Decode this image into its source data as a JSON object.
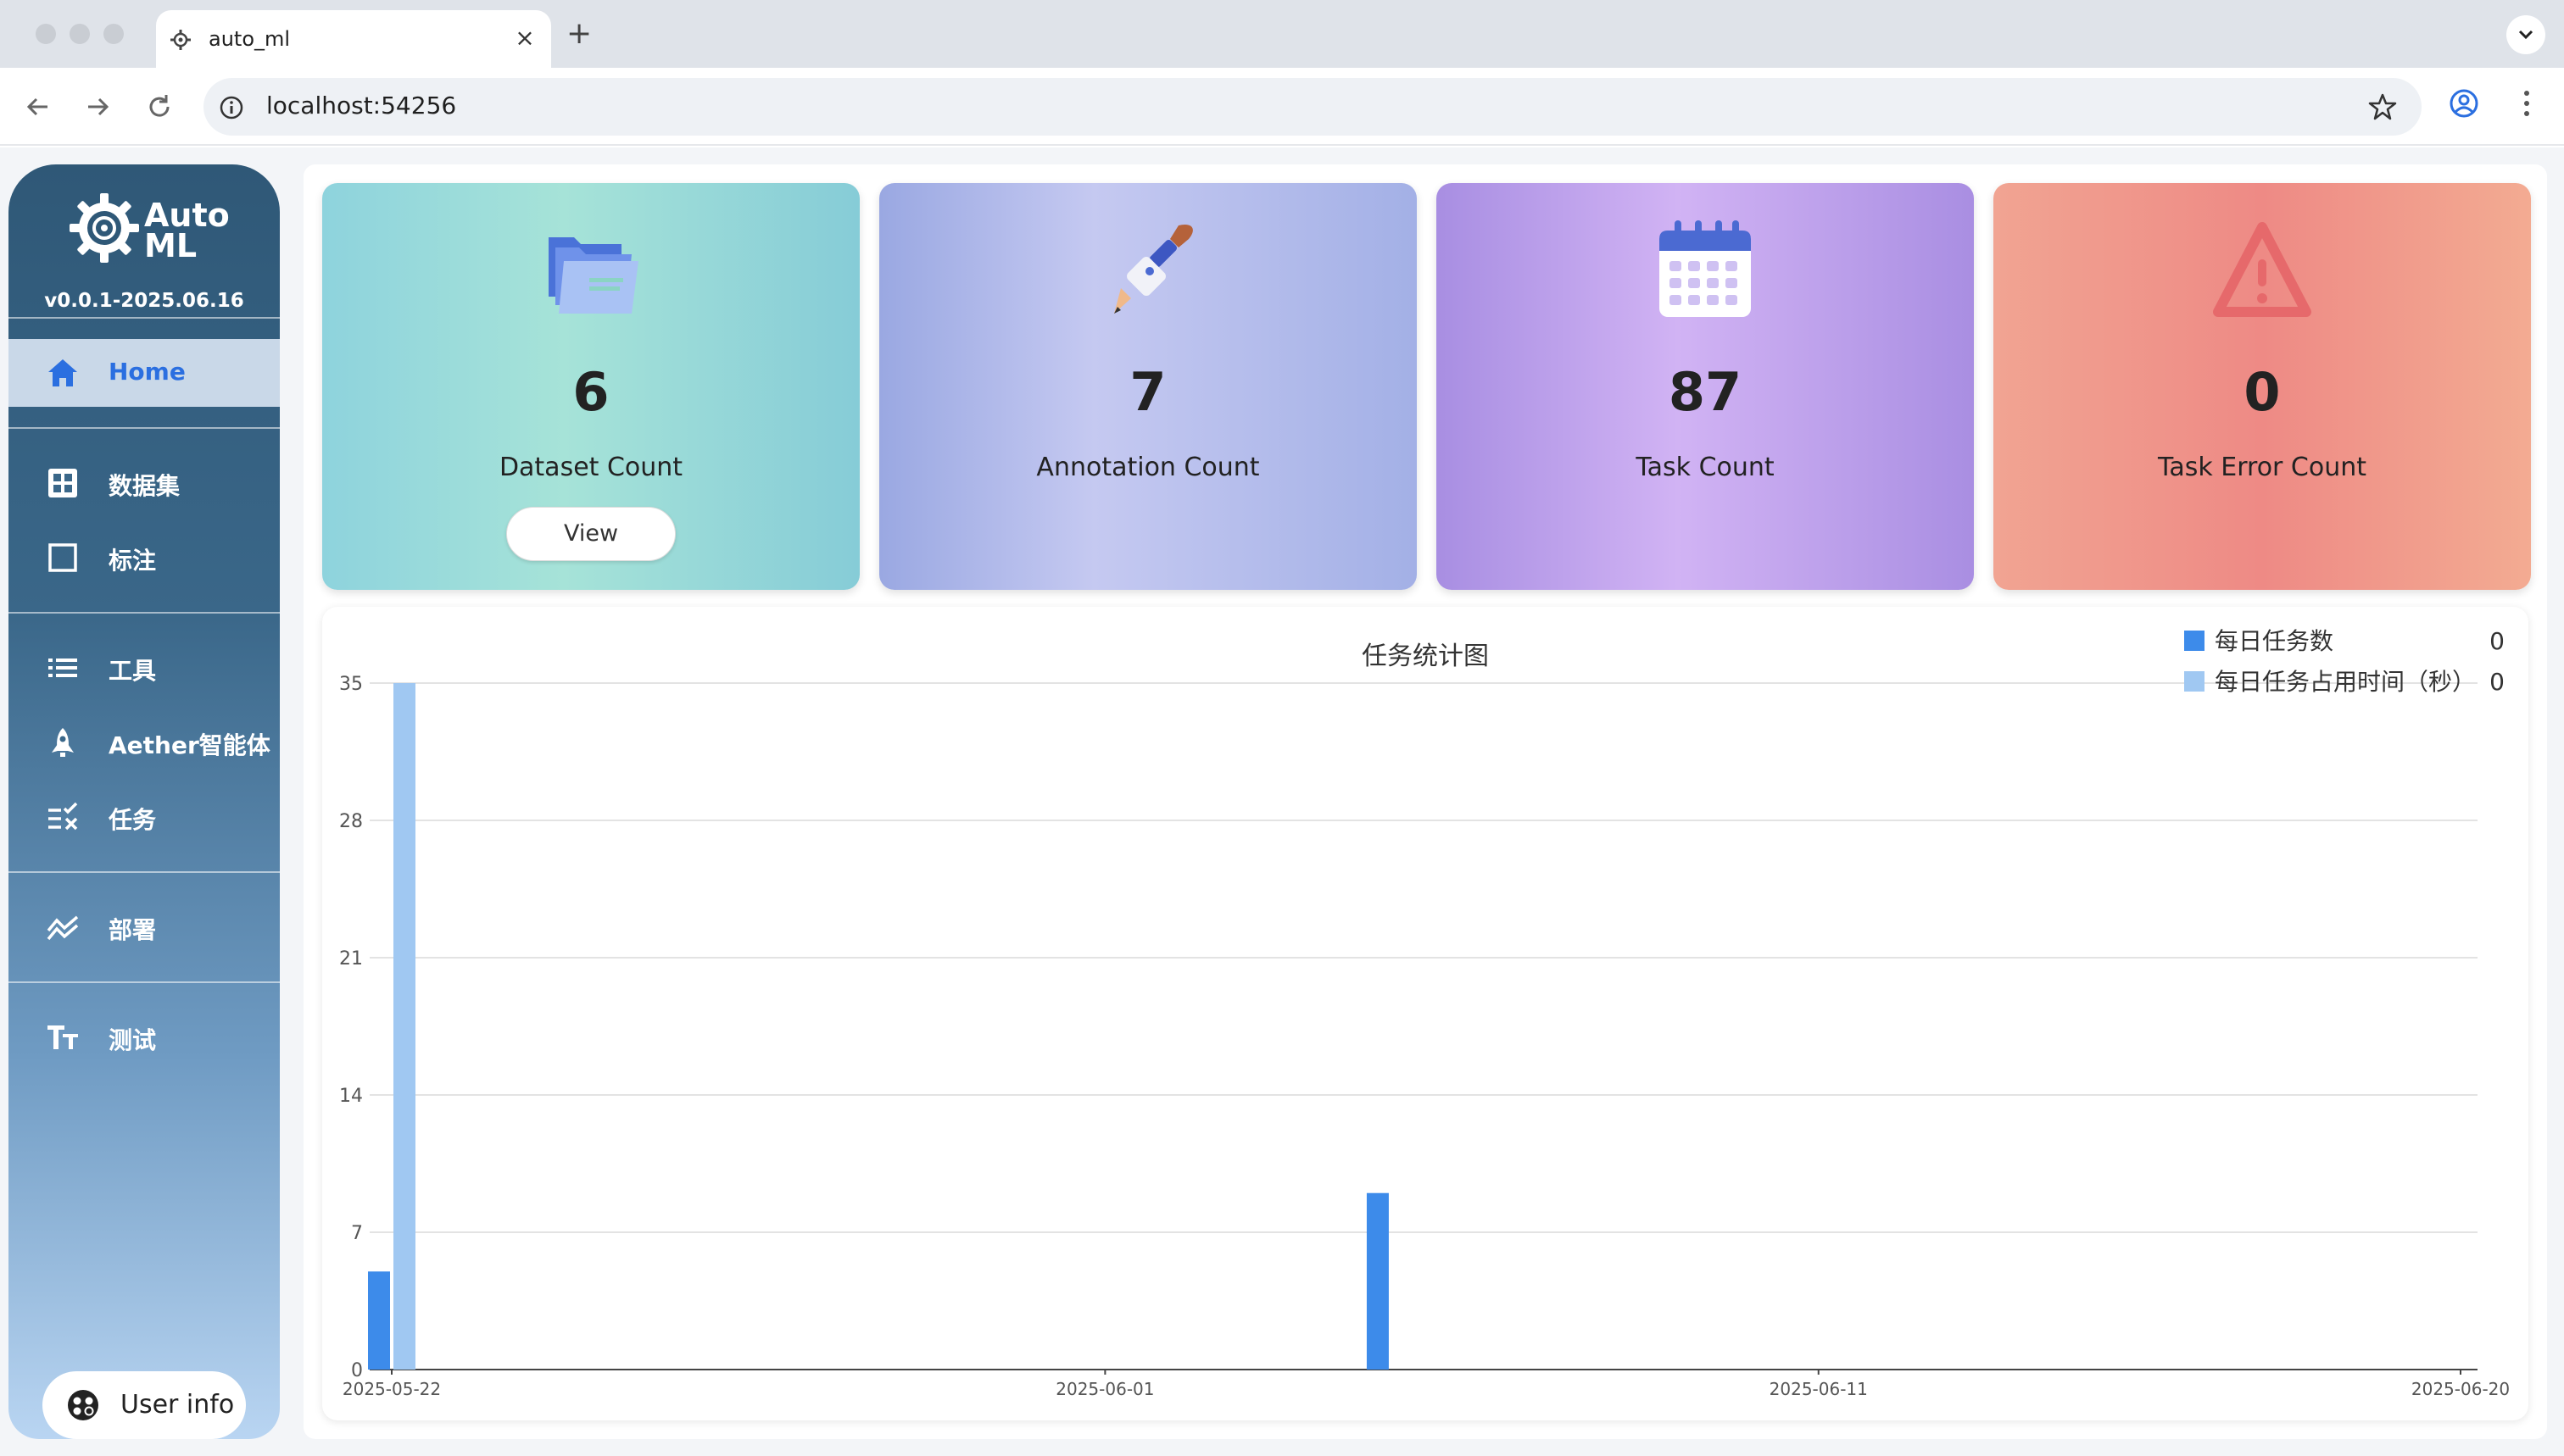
{
  "browser": {
    "tab_title": "auto_ml",
    "url": "localhost:54256"
  },
  "sidebar": {
    "logo_text_line1": "Auto",
    "logo_text_line2": "ML",
    "version": "v0.0.1-2025.06.16",
    "items": [
      {
        "label": "Home",
        "icon": "home-icon",
        "active": true
      },
      {
        "label": "数据集",
        "icon": "grid-icon"
      },
      {
        "label": "标注",
        "icon": "square-icon"
      },
      {
        "label": "工具",
        "icon": "list-icon"
      },
      {
        "label": "Aether智能体",
        "icon": "rocket-icon"
      },
      {
        "label": "任务",
        "icon": "task-check-icon"
      },
      {
        "label": "部署",
        "icon": "chart-line-icon"
      },
      {
        "label": "测试",
        "icon": "text-size-icon"
      }
    ],
    "user_info": "User info"
  },
  "cards": [
    {
      "value": "6",
      "label": "Dataset Count",
      "button": "View",
      "icon": "folder-icon"
    },
    {
      "value": "7",
      "label": "Annotation Count",
      "icon": "brush-icon"
    },
    {
      "value": "87",
      "label": "Task Count",
      "icon": "calendar-icon"
    },
    {
      "value": "0",
      "label": "Task Error Count",
      "icon": "warning-icon"
    }
  ],
  "chart_data": {
    "type": "bar",
    "title": "任务统计图",
    "x_ticks": [
      "2025-05-22",
      "2025-06-01",
      "2025-06-11",
      "2025-06-20"
    ],
    "y_ticks": [
      0,
      7,
      14,
      21,
      28,
      35
    ],
    "ylim": [
      0,
      35
    ],
    "xlim": [
      "2025-05-22",
      "2025-06-20"
    ],
    "legend_position": "top-right",
    "grid": true,
    "series": [
      {
        "name": "每日任务数",
        "legend_value": "0",
        "color": "#3d8bea",
        "points": [
          {
            "x": "2025-05-22",
            "y": 5
          },
          {
            "x": "2025-06-05",
            "y": 9
          }
        ]
      },
      {
        "name": "每日任务占用时间（秒）",
        "legend_value": "0",
        "color": "#a0c8f2",
        "points": [
          {
            "x": "2025-05-22",
            "y": 35
          }
        ]
      }
    ]
  }
}
